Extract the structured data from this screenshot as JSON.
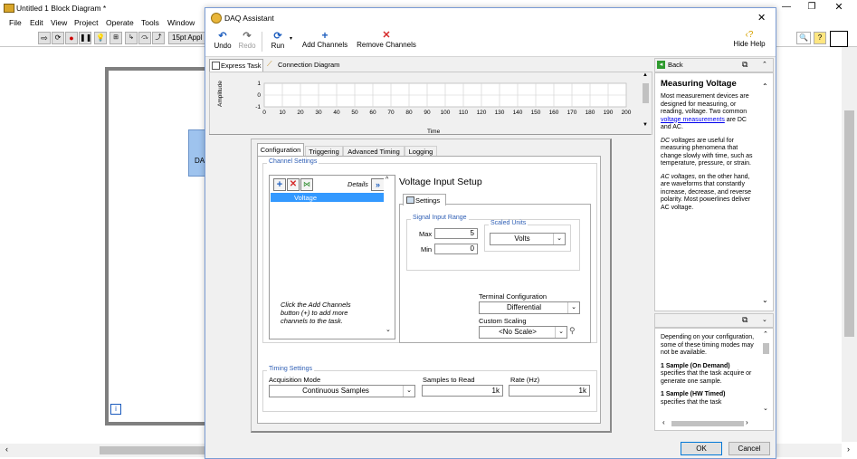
{
  "bg_window": {
    "title": "Untitled 1 Block Diagram *",
    "menu": [
      "File",
      "Edit",
      "View",
      "Project",
      "Operate",
      "Tools",
      "Window"
    ],
    "font_label": "15pt Appl",
    "canvas_label": "DA"
  },
  "dialog": {
    "title": "DAQ Assistant",
    "toolbar": {
      "undo": "Undo",
      "redo": "Redo",
      "run": "Run",
      "add_channels": "Add Channels",
      "remove_channels": "Remove Channels",
      "hide_help": "Hide Help"
    },
    "view_tabs": {
      "express_task": "Express Task",
      "connection_diagram": "Connection Diagram"
    },
    "graph": {
      "ylabel": "Amplitude",
      "xlabel": "Time",
      "yticks": [
        "1",
        "0",
        "-1"
      ],
      "xticks": [
        "0",
        "10",
        "20",
        "30",
        "40",
        "50",
        "60",
        "70",
        "80",
        "90",
        "100",
        "110",
        "120",
        "130",
        "140",
        "150",
        "160",
        "170",
        "180",
        "190",
        "200"
      ]
    },
    "config_tabs": [
      "Configuration",
      "Triggering",
      "Advanced Timing",
      "Logging"
    ],
    "channel_settings": {
      "label": "Channel Settings",
      "details": "Details",
      "channels": [
        "Voltage"
      ],
      "hint": "Click the Add Channels button (+) to add more channels to the task."
    },
    "voltage_setup": {
      "title": "Voltage Input Setup",
      "settings_tab": "Settings",
      "signal_range_label": "Signal Input Range",
      "max_label": "Max",
      "max_value": "5",
      "min_label": "Min",
      "min_value": "0",
      "scaled_units_label": "Scaled Units",
      "scaled_units_value": "Volts",
      "terminal_config_label": "Terminal Configuration",
      "terminal_config_value": "Differential",
      "custom_scaling_label": "Custom Scaling",
      "custom_scaling_value": "<No Scale>"
    },
    "timing": {
      "label": "Timing Settings",
      "acq_mode_label": "Acquisition Mode",
      "acq_mode_value": "Continuous Samples",
      "samples_label": "Samples to Read",
      "samples_value": "1k",
      "rate_label": "Rate (Hz)",
      "rate_value": "1k"
    },
    "help": {
      "back": "Back",
      "heading": "Measuring Voltage",
      "p1": "Most measurement devices are designed for measuring, or reading, voltage. Two common",
      "p1_link": "voltage measurements",
      "p1_end": "are DC and AC.",
      "p2_em": "DC voltages",
      "p2": "are useful for measuring phenomena that change slowly with time, such as temperature, pressure, or strain.",
      "p3_em": "AC voltages",
      "p3": ", on the other hand, are waveforms that constantly increase, decrease, and reverse polarity. Most powerlines deliver AC voltage.",
      "lower_p1": "Depending on your configuration, some of these timing modes may not be available.",
      "lower_h1": "1 Sample (On Demand)",
      "lower_p2": "specifies that the task acquire or generate one sample.",
      "lower_h2": "1 Sample (HW Timed)",
      "lower_p3": "specifies that the task"
    },
    "ok": "OK",
    "cancel": "Cancel"
  },
  "colors": {
    "accent": "#3c78d8",
    "selection": "#3399ff",
    "link": "#0000ee",
    "group_label": "#2f5fb5",
    "remove_red": "#d62b2b"
  }
}
